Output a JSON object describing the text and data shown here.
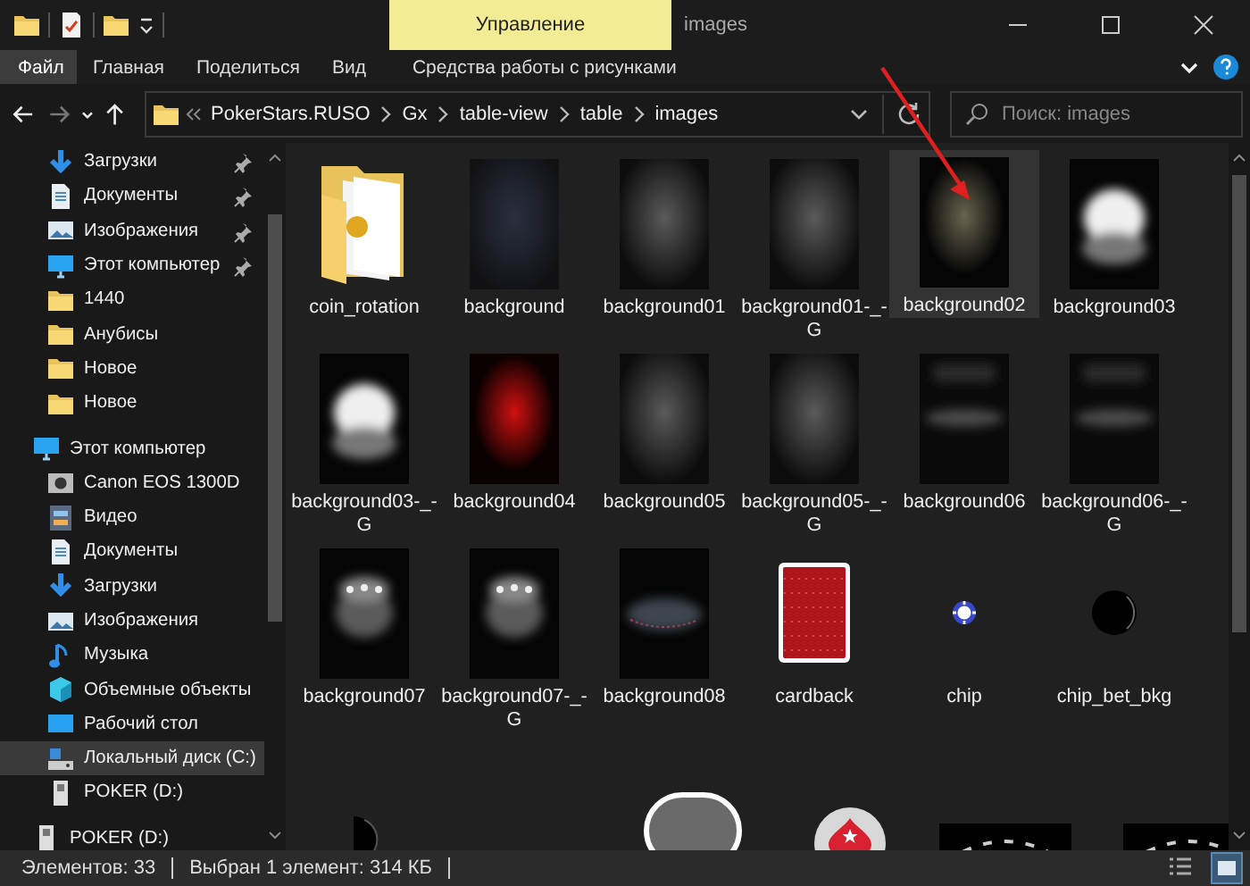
{
  "window": {
    "title": "images",
    "contextual_group": "Управление"
  },
  "ribbon": {
    "tabs": [
      {
        "label": "Файл",
        "kind": "file",
        "selected": false
      },
      {
        "label": "Главная",
        "kind": "tab",
        "selected": false
      },
      {
        "label": "Поделиться",
        "kind": "tab",
        "selected": false
      },
      {
        "label": "Вид",
        "kind": "tab",
        "selected": false
      },
      {
        "label": "Средства работы с рисунками",
        "kind": "contextual",
        "selected": false
      }
    ]
  },
  "navigation": {
    "back_disabled": false,
    "forward_disabled": true
  },
  "address": {
    "crumbs": [
      "PokerStars.RUSO",
      "Gx",
      "table-view",
      "table",
      "images"
    ]
  },
  "search": {
    "placeholder": "Поиск: images"
  },
  "sidebar": {
    "quick_access": [
      {
        "label": "Загрузки",
        "kind": "download",
        "pinned": true,
        "selected": false
      },
      {
        "label": "Документы",
        "kind": "document",
        "pinned": true,
        "selected": false
      },
      {
        "label": "Изображения",
        "kind": "image",
        "pinned": true,
        "selected": false
      },
      {
        "label": "Этот компьютер",
        "kind": "computer",
        "pinned": true,
        "selected": false
      },
      {
        "label": "1440",
        "kind": "folder",
        "pinned": false,
        "selected": false
      },
      {
        "label": "Анубисы",
        "kind": "folder",
        "pinned": false,
        "selected": false
      },
      {
        "label": "Новое",
        "kind": "folder",
        "pinned": false,
        "selected": false
      },
      {
        "label": "Новое",
        "kind": "folder",
        "pinned": false,
        "selected": false
      }
    ],
    "tree": [
      {
        "label": "Этот компьютер",
        "kind": "computer",
        "selected": false,
        "children": [
          {
            "label": "Canon EOS 1300D",
            "kind": "camera",
            "selected": false
          },
          {
            "label": "Видео",
            "kind": "video",
            "selected": false
          },
          {
            "label": "Документы",
            "kind": "document",
            "selected": false
          },
          {
            "label": "Загрузки",
            "kind": "download",
            "selected": false
          },
          {
            "label": "Изображения",
            "kind": "image",
            "selected": false
          },
          {
            "label": "Музыка",
            "kind": "music",
            "selected": false
          },
          {
            "label": "Объемные объекты",
            "kind": "cube",
            "selected": false
          },
          {
            "label": "Рабочий стол",
            "kind": "desktop",
            "selected": false
          },
          {
            "label": "Локальный диск (C:)",
            "kind": "drive",
            "selected": true
          },
          {
            "label": "POKER (D:)",
            "kind": "usb",
            "selected": false
          }
        ]
      },
      {
        "label": "POKER (D:)",
        "kind": "usb",
        "selected": false
      }
    ]
  },
  "files": {
    "items": [
      {
        "name": "coin_rotation",
        "kind": "folder",
        "selected": false
      },
      {
        "name": "background",
        "kind": "glow-blue",
        "selected": false
      },
      {
        "name": "background01",
        "kind": "glow-dim",
        "selected": false
      },
      {
        "name": "background01-_-G",
        "kind": "glow-dim",
        "selected": false
      },
      {
        "name": "background02",
        "kind": "glow-warm",
        "selected": true
      },
      {
        "name": "background03",
        "kind": "glow-bright",
        "selected": false
      },
      {
        "name": "background03-_-G",
        "kind": "glow-bright",
        "selected": false
      },
      {
        "name": "background04",
        "kind": "glow-red",
        "selected": false
      },
      {
        "name": "background05",
        "kind": "glow-dim",
        "selected": false
      },
      {
        "name": "background05-_-G",
        "kind": "glow-dim",
        "selected": false
      },
      {
        "name": "background06",
        "kind": "lights-band",
        "selected": false
      },
      {
        "name": "background06-_-G",
        "kind": "lights-band",
        "selected": false
      },
      {
        "name": "background07",
        "kind": "lights-dots",
        "selected": false
      },
      {
        "name": "background07-_-G",
        "kind": "lights-dots",
        "selected": false
      },
      {
        "name": "background08",
        "kind": "rail",
        "selected": false
      },
      {
        "name": "cardback",
        "kind": "card",
        "selected": false
      },
      {
        "name": "chip",
        "kind": "chip",
        "selected": false
      },
      {
        "name": "chip_bet_bkg",
        "kind": "ball",
        "selected": false
      }
    ],
    "partial_items": [
      {
        "kind": "half-ball"
      },
      {
        "kind": "pill"
      },
      {
        "kind": "spade-logo"
      },
      {
        "kind": "table-arc"
      },
      {
        "kind": "table-arc"
      }
    ]
  },
  "status_bar": {
    "item_count": "Элементов: 33",
    "selection": "Выбран 1 элемент: 314 КБ"
  }
}
